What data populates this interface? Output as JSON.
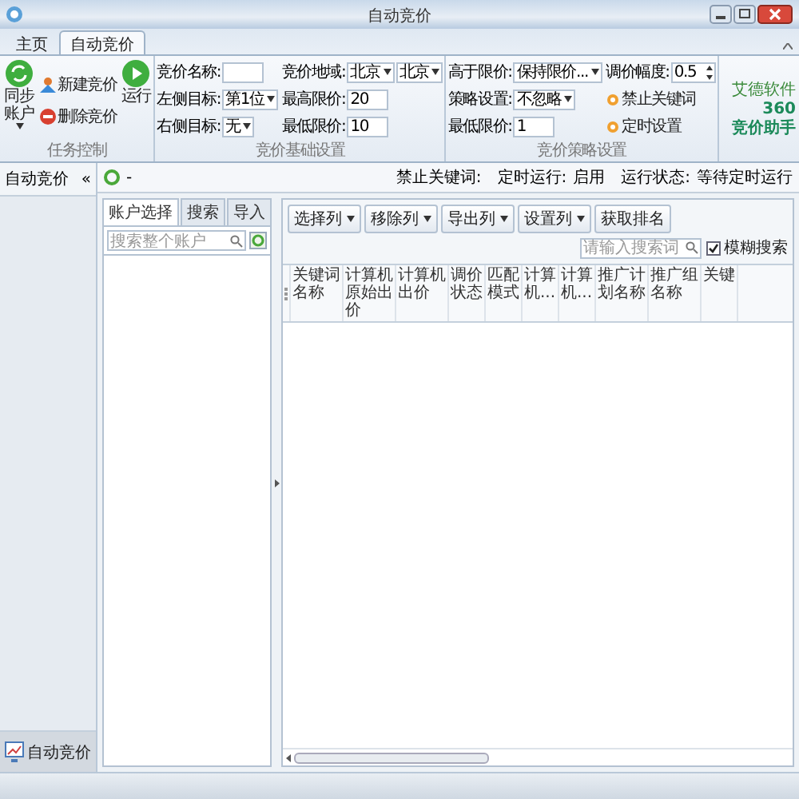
{
  "window": {
    "title": "自动竞价"
  },
  "ribbon_tabs": [
    {
      "label": "主页",
      "selected": false
    },
    {
      "label": "自动竞价",
      "selected": true
    }
  ],
  "task_control": {
    "label": "任务控制",
    "sync": "同步账户",
    "new": "新建竞价",
    "delete": "删除竞价",
    "run": "运行"
  },
  "basic_settings": {
    "label": "竞价基础设置",
    "fields": [
      {
        "label": "竞价名称:",
        "kind": "input"
      },
      {
        "label": "左侧目标:",
        "kind": "select",
        "value": "第1位"
      },
      {
        "label": "右侧目标:",
        "kind": "select",
        "value": "无"
      },
      {
        "label": "竞价地域:",
        "kind": "select2",
        "values": [
          "北京",
          "北京"
        ]
      },
      {
        "label": "最高限价:",
        "kind": "input",
        "value": "20"
      },
      {
        "label": "最低限价:",
        "kind": "input",
        "value": "10"
      }
    ]
  },
  "strategy_settings": {
    "label": "竞价策略设置",
    "fields": [
      {
        "label": "高于限价:",
        "kind": "select",
        "value": "保持限价..."
      },
      {
        "label": "策略设置:",
        "kind": "select",
        "value": "不忽略"
      },
      {
        "label": "最低限价:",
        "kind": "input",
        "value": "1"
      },
      {
        "label": "调价幅度:",
        "kind": "spin",
        "value": "0.5"
      },
      {
        "label": "禁止关键词",
        "kind": "link"
      },
      {
        "label": "定时设置",
        "kind": "link"
      }
    ]
  },
  "logo": {
    "company": "艾德软件",
    "number": "360",
    "name": "竞价助手"
  },
  "sidebar": {
    "title": "自动竞价",
    "collapse": "«",
    "nav_items": [
      {
        "label": "自动竞价",
        "selected": true
      }
    ]
  },
  "toolbar": {
    "title": "-",
    "status": [
      {
        "label": "禁止关键词:"
      },
      {
        "label": "定时运行:",
        "value": "启用"
      },
      {
        "label": "运行状态:",
        "value": "等待定时运行"
      }
    ]
  },
  "account_panel": {
    "tabs": [
      {
        "label": "账户选择",
        "selected": true
      },
      {
        "label": "搜索",
        "selected": false
      },
      {
        "label": "导入",
        "selected": false
      }
    ],
    "search": {
      "placeholder": "搜索整个账户"
    }
  },
  "keyword_panel": {
    "buttons": [
      {
        "label": "选择列",
        "dropdown": true
      },
      {
        "label": "移除列",
        "dropdown": true
      },
      {
        "label": "导出列",
        "dropdown": true
      },
      {
        "label": "设置列",
        "dropdown": true
      },
      {
        "label": "获取排名",
        "dropdown": false
      }
    ],
    "search": {
      "placeholder": "请输入搜索词"
    },
    "filter": {
      "label": "模糊搜索",
      "checked": true
    },
    "table": {
      "columns": [
        "关键词名称",
        "计算机原始出价",
        "计算机出价",
        "调价状态",
        "匹配模式",
        "计算机...",
        "计算机...",
        "推广计划名称",
        "推广组名称",
        "关键"
      ]
    }
  }
}
